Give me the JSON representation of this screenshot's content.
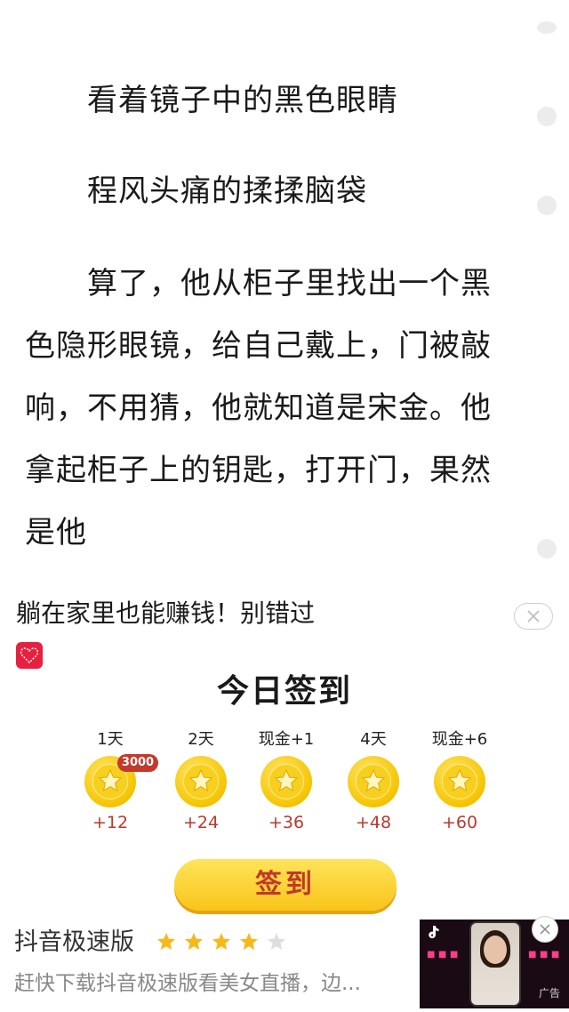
{
  "story": {
    "paragraphs": [
      "看着镜子中的黑色眼睛",
      "程风头痛的揉揉脑袋",
      "算了，他从柜子里找出一个黑色隐形眼镜，给自己戴上，门被敲响，不用猜，他就知道是宋金。他拿起柜子上的钥匙，打开门，果然是他"
    ]
  },
  "ad_signin": {
    "headline": "躺在家里也能赚钱！别错过",
    "title": "今日签到",
    "badge": "3000",
    "button": "签到",
    "days": [
      {
        "label": "1天",
        "value": "+12"
      },
      {
        "label": "2天",
        "value": "+24"
      },
      {
        "label": "现金+1",
        "value": "+36"
      },
      {
        "label": "4天",
        "value": "+48"
      },
      {
        "label": "现金+6",
        "value": "+60"
      }
    ]
  },
  "ad_app": {
    "name": "抖音极速版",
    "rating": 4,
    "rating_max": 5,
    "description": "赶快下载抖音极速版看美女直播，边...",
    "ad_label": "广告"
  },
  "colors": {
    "coin": "#f5c400",
    "button": "#f8c41a",
    "value_text": "#b53a2e",
    "badge": "#c23a2e"
  }
}
